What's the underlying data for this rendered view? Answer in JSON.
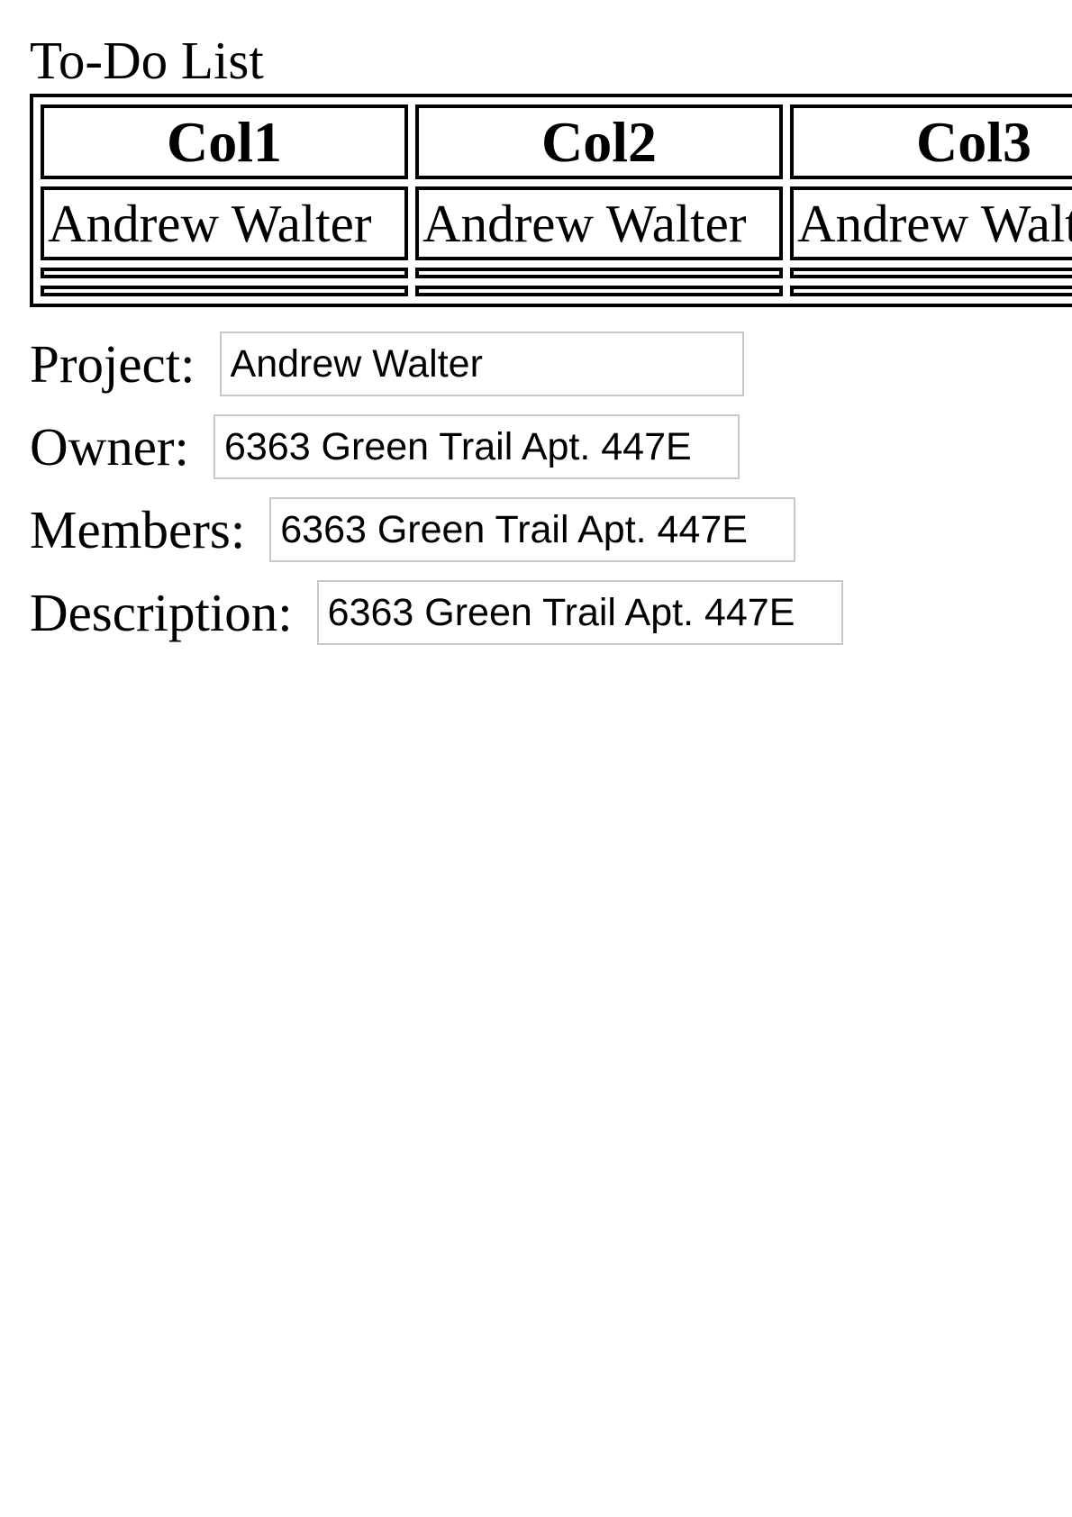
{
  "page": {
    "title": "To-Do List"
  },
  "table": {
    "headers": [
      "Col1",
      "Col2",
      "Col3"
    ],
    "rows": [
      [
        "Andrew Walter",
        "Andrew Walter",
        "Andrew Walter"
      ]
    ]
  },
  "form": {
    "project": {
      "label": "Project:",
      "value": "Andrew Walter"
    },
    "owner": {
      "label": "Owner:",
      "value": "6363 Green Trail Apt. 447E"
    },
    "members": {
      "label": "Members:",
      "value": "6363 Green Trail Apt. 447E"
    },
    "description": {
      "label": "Description:",
      "value": "6363 Green Trail Apt. 447E"
    }
  }
}
